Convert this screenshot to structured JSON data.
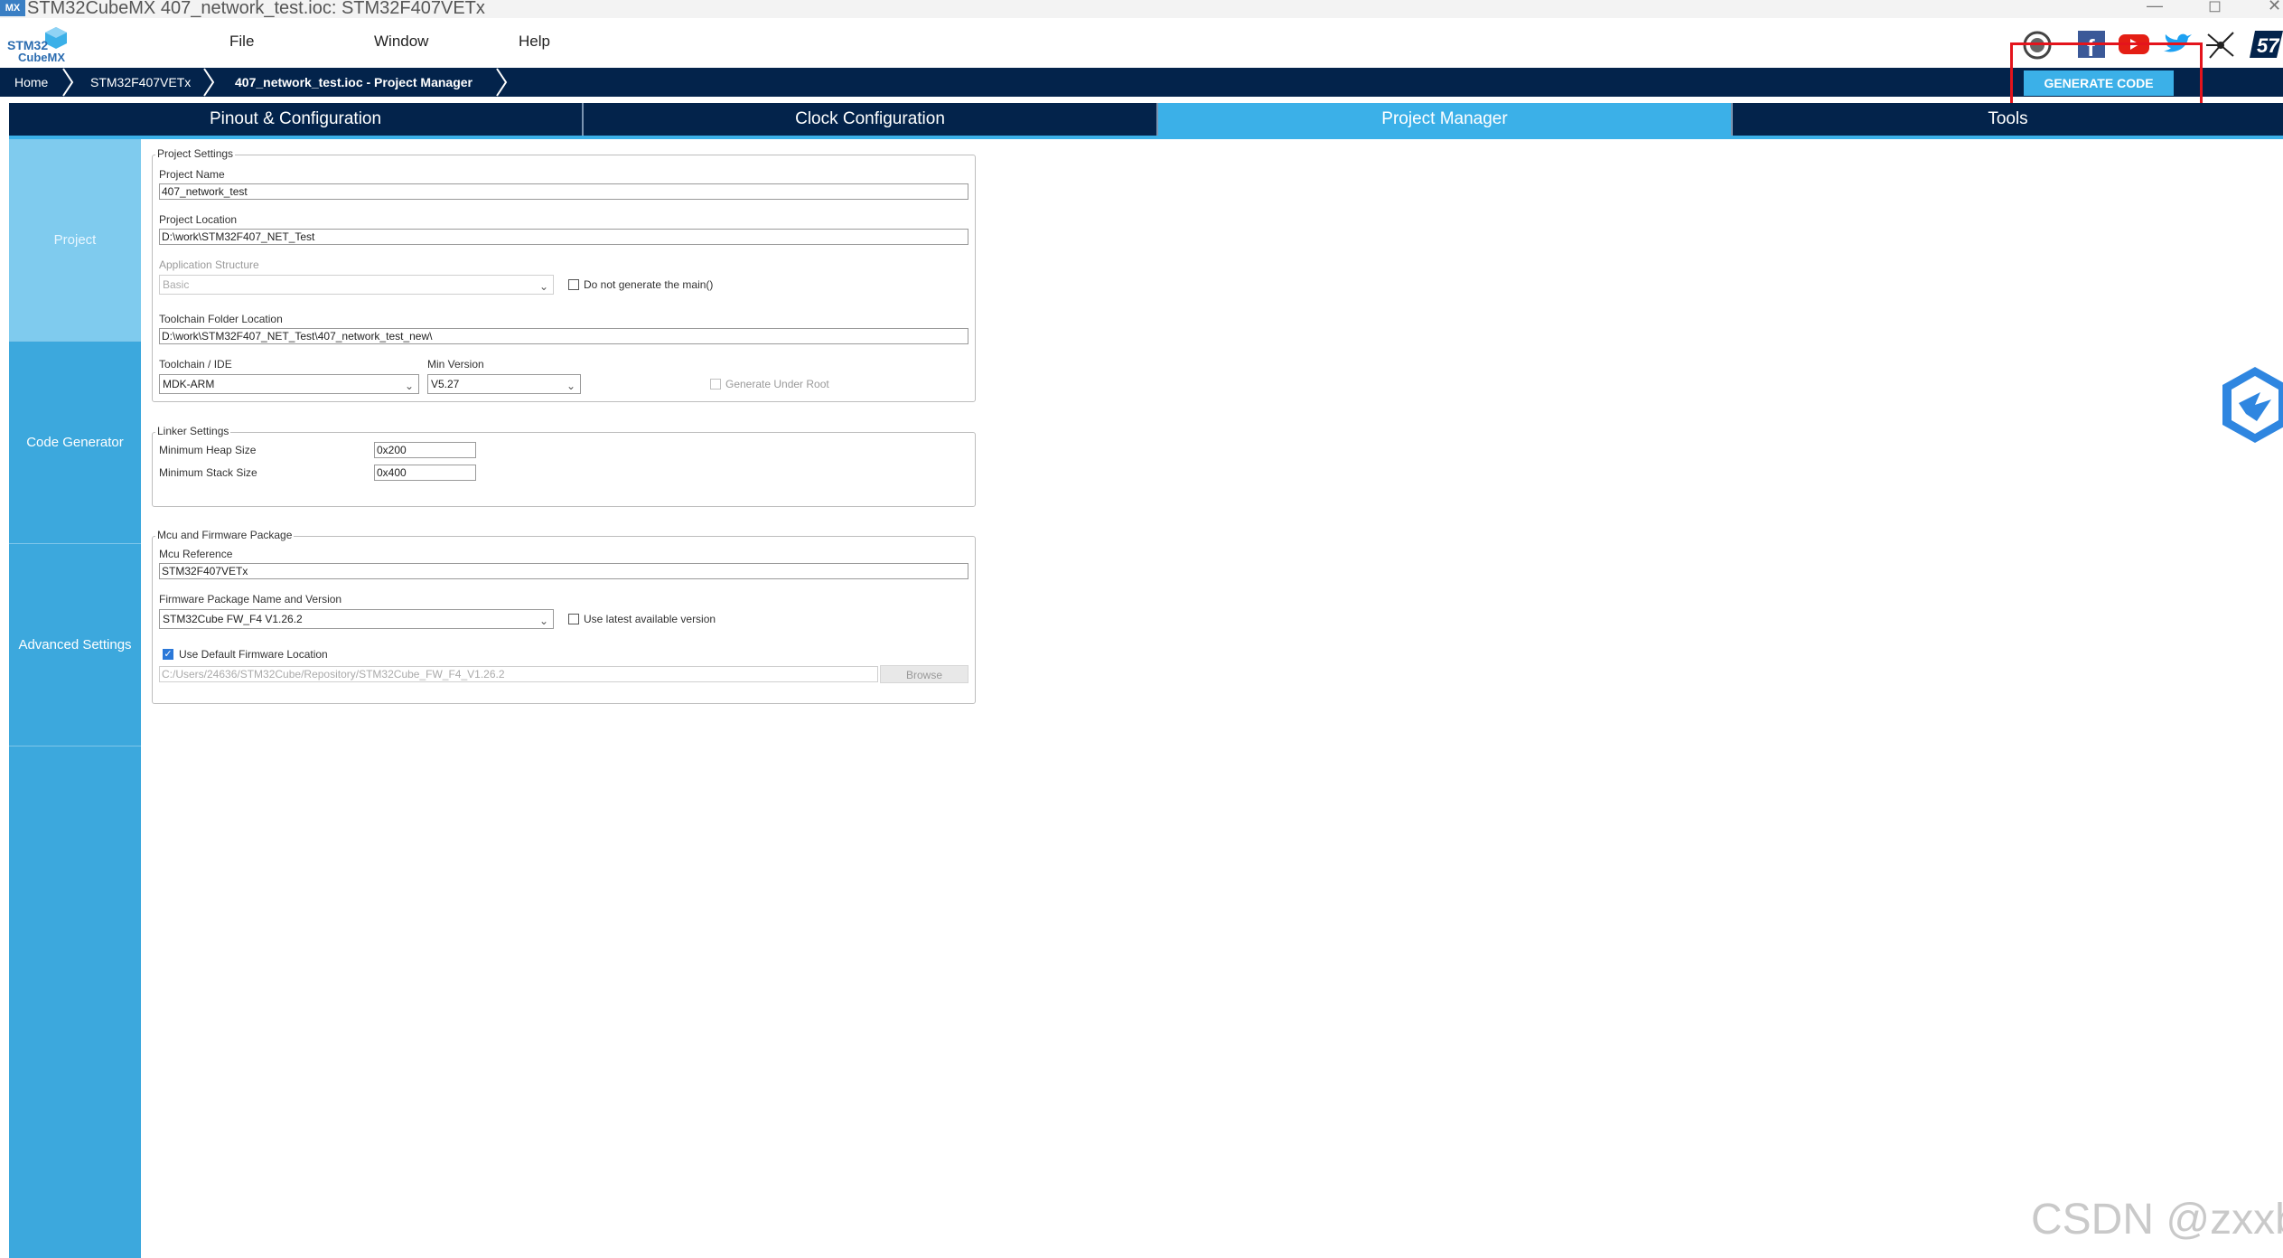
{
  "window": {
    "app_icon": "MX",
    "title": "STM32CubeMX 407_network_test.ioc: STM32F407VETx",
    "controls": [
      "—",
      "◻",
      "✕"
    ]
  },
  "logo": {
    "line1": "STM32",
    "line2": "CubeMX"
  },
  "menu": [
    "File",
    "Window",
    "Help"
  ],
  "social_icons": [
    "anniversary-badge-icon",
    "facebook-icon",
    "youtube-icon",
    "twitter-icon",
    "network-icon",
    "st-logo-icon"
  ],
  "breadcrumb": [
    "Home",
    "STM32F407VETx",
    "407_network_test.ioc - Project Manager"
  ],
  "generate_button": "GENERATE CODE",
  "tabs": [
    {
      "label": "Pinout & Configuration",
      "active": false
    },
    {
      "label": "Clock Configuration",
      "active": false
    },
    {
      "label": "Project Manager",
      "active": true
    },
    {
      "label": "Tools",
      "active": false
    }
  ],
  "left_nav": [
    "Project",
    "Code Generator",
    "Advanced Settings"
  ],
  "project_settings": {
    "legend": "Project Settings",
    "project_name_label": "Project Name",
    "project_name": "407_network_test",
    "project_location_label": "Project Location",
    "project_location": "D:\\work\\STM32F407_NET_Test",
    "app_structure_label": "Application Structure",
    "app_structure": "Basic",
    "no_main_label": "Do not generate the main()",
    "no_main_checked": false,
    "toolchain_folder_label": "Toolchain Folder Location",
    "toolchain_folder": "D:\\work\\STM32F407_NET_Test\\407_network_test_new\\",
    "toolchain_label": "Toolchain / IDE",
    "toolchain": "MDK-ARM",
    "min_version_label": "Min Version",
    "min_version": "V5.27",
    "gen_under_root_label": "Generate Under Root",
    "gen_under_root_checked": false
  },
  "linker_settings": {
    "legend": "Linker Settings",
    "heap_label": "Minimum Heap Size",
    "heap": "0x200",
    "stack_label": "Minimum Stack Size",
    "stack": "0x400"
  },
  "mcu_firmware": {
    "legend": "Mcu and Firmware Package",
    "mcu_ref_label": "Mcu Reference",
    "mcu_ref": "STM32F407VETx",
    "fw_label": "Firmware Package Name and Version",
    "fw": "STM32Cube FW_F4 V1.26.2",
    "latest_label": "Use latest available version",
    "latest_checked": false,
    "default_loc_label": "Use Default Firmware Location",
    "default_loc_checked": true,
    "fw_path": "C:/Users/24636/STM32Cube/Repository/STM32Cube_FW_F4_V1.26.2",
    "browse": "Browse"
  },
  "watermark": "CSDN @zxxb",
  "colors": {
    "dark_navy": "#03234b",
    "accent": "#3bb0e8",
    "nav": "#3ca8dd",
    "highlight": "#e4141c"
  }
}
